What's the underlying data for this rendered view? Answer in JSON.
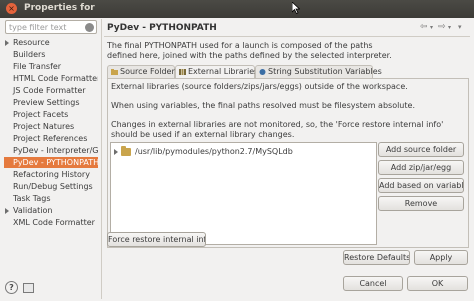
{
  "window": {
    "title": "Properties for",
    "close_glyph": "×"
  },
  "filter": {
    "placeholder": "type filter text"
  },
  "tree": {
    "items": [
      {
        "label": "Resource",
        "expandable": true
      },
      {
        "label": "Builders",
        "expandable": false
      },
      {
        "label": "File Transfer",
        "expandable": false
      },
      {
        "label": "HTML Code Formatter",
        "expandable": false
      },
      {
        "label": "JS Code Formatter",
        "expandable": false
      },
      {
        "label": "Preview Settings",
        "expandable": false
      },
      {
        "label": "Project Facets",
        "expandable": false
      },
      {
        "label": "Project Natures",
        "expandable": false
      },
      {
        "label": "Project References",
        "expandable": false
      },
      {
        "label": "PyDev - Interpreter/Gra",
        "expandable": false
      },
      {
        "label": "PyDev - PYTHONPATH",
        "expandable": false,
        "selected": true
      },
      {
        "label": "Refactoring History",
        "expandable": false
      },
      {
        "label": "Run/Debug Settings",
        "expandable": false
      },
      {
        "label": "Task Tags",
        "expandable": false
      },
      {
        "label": "Validation",
        "expandable": true
      },
      {
        "label": "XML Code Formatter",
        "expandable": false
      }
    ]
  },
  "page": {
    "title": "PyDev - PYTHONPATH",
    "description_line1": "The final PYTHONPATH used for a launch is composed of the paths",
    "description_line2": "defined here, joined with the paths defined by the selected interpreter."
  },
  "tabs": [
    {
      "label": "Source Folders",
      "active": false
    },
    {
      "label": "External Libraries",
      "active": true
    },
    {
      "label": "String Substitution Variables",
      "active": false
    }
  ],
  "panel": {
    "text1_line1": "External libraries (source folders/zips/jars/eggs) outside of the workspace.",
    "text2_line1": "When using variables, the final paths resolved must be filesystem absolute.",
    "text3_line1": "Changes in external libraries are not monitored, so, the 'Force restore internal info'",
    "text3_line2": "should be used if an external library changes.",
    "list_items": [
      "/usr/lib/pymodules/python2.7/MySQLdb"
    ]
  },
  "buttons": {
    "add_source_folder": "Add source folder",
    "add_zip": "Add zip/jar/egg",
    "add_variable": "Add based on variable",
    "remove": "Remove",
    "force_restore": "Force restore internal info",
    "restore_defaults": "Restore Defaults",
    "apply": "Apply",
    "cancel": "Cancel",
    "ok": "OK"
  },
  "colors": {
    "selection": "#e57a3e",
    "titlebar": "#3c3b37",
    "folder_icon": "#c9a44c"
  },
  "icons": {
    "help": "help-icon",
    "import": "import-icon",
    "back": "back-arrow-icon",
    "forward": "forward-arrow-icon",
    "menu": "view-menu-icon"
  }
}
